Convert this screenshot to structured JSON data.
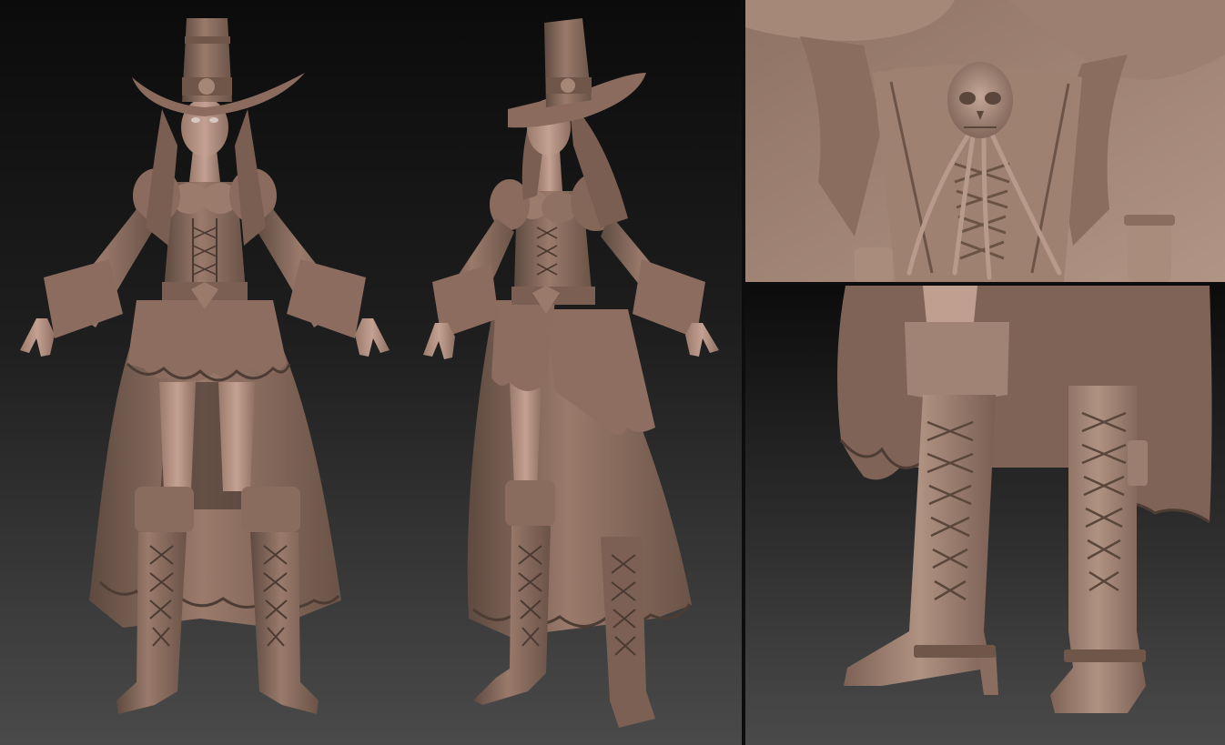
{
  "scene": {
    "subject": "",
    "colors": {
      "clay": "#8d6f61",
      "clay_light": "#b89888",
      "clay_dark": "#5a463d",
      "skin": "#b89586",
      "bg_top": "#0b0b0b",
      "bg_bottom": "#4a4a4a",
      "closeup_bg": "#a78a7c"
    },
    "panels": [
      "front-view",
      "three-quarter-view",
      "corset-closeup",
      "boots-closeup"
    ]
  }
}
